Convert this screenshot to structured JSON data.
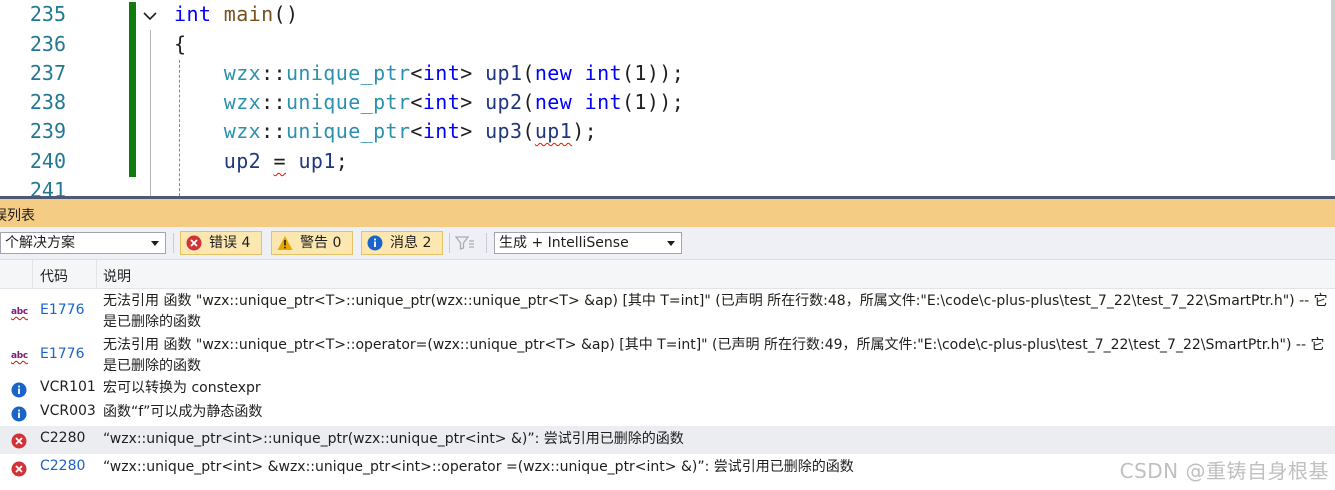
{
  "editor": {
    "lines": [
      {
        "num": "235",
        "tokens": [
          {
            "t": "int",
            "c": "kw"
          },
          {
            "t": " "
          },
          {
            "t": "main",
            "c": "fn"
          },
          {
            "t": "()"
          }
        ]
      },
      {
        "num": "236",
        "tokens": [
          {
            "t": "{"
          }
        ]
      },
      {
        "num": "237",
        "tokens": [
          {
            "t": "    "
          },
          {
            "t": "wzx",
            "c": "ns"
          },
          {
            "t": "::"
          },
          {
            "t": "unique_ptr",
            "c": "ns"
          },
          {
            "t": "<"
          },
          {
            "t": "int",
            "c": "kw"
          },
          {
            "t": "> "
          },
          {
            "t": "up1",
            "c": "var"
          },
          {
            "t": "("
          },
          {
            "t": "new",
            "c": "kw"
          },
          {
            "t": " "
          },
          {
            "t": "int",
            "c": "kw"
          },
          {
            "t": "(1));"
          }
        ]
      },
      {
        "num": "238",
        "tokens": [
          {
            "t": "    "
          },
          {
            "t": "wzx",
            "c": "ns"
          },
          {
            "t": "::"
          },
          {
            "t": "unique_ptr",
            "c": "ns"
          },
          {
            "t": "<"
          },
          {
            "t": "int",
            "c": "kw"
          },
          {
            "t": "> "
          },
          {
            "t": "up2",
            "c": "var"
          },
          {
            "t": "("
          },
          {
            "t": "new",
            "c": "kw"
          },
          {
            "t": " "
          },
          {
            "t": "int",
            "c": "kw"
          },
          {
            "t": "(1));"
          }
        ]
      },
      {
        "num": "239",
        "tokens": [
          {
            "t": "    "
          },
          {
            "t": "wzx",
            "c": "ns"
          },
          {
            "t": "::"
          },
          {
            "t": "unique_ptr",
            "c": "ns"
          },
          {
            "t": "<"
          },
          {
            "t": "int",
            "c": "kw"
          },
          {
            "t": "> "
          },
          {
            "t": "up3",
            "c": "var"
          },
          {
            "t": "("
          },
          {
            "t": "up1",
            "c": "var squig"
          },
          {
            "t": ");"
          }
        ]
      },
      {
        "num": "240",
        "tokens": [
          {
            "t": "    "
          },
          {
            "t": "up2",
            "c": "var"
          },
          {
            "t": " "
          },
          {
            "t": "=",
            "c": "squig"
          },
          {
            "t": " "
          },
          {
            "t": "up1",
            "c": "var"
          },
          {
            "t": ";"
          }
        ]
      },
      {
        "num": "241",
        "tokens": []
      }
    ]
  },
  "panel": {
    "title": "误列表",
    "scope_select": "个解决方案",
    "errors_btn": "错误 4",
    "warnings_btn": "警告 0",
    "messages_btn": "消息 2",
    "build_select": "生成 + IntelliSense",
    "col_code": "代码",
    "col_desc": "说明",
    "rows": [
      {
        "icon": "spelling-abc-icon",
        "code": "E1776",
        "link": true,
        "desc": "无法引用 函数 \"wzx::unique_ptr<T>::unique_ptr(wzx::unique_ptr<T> &ap) [其中 T=int]\" (已声明 所在行数:48，所属文件:\"E:\\code\\c-plus-plus\\test_7_22\\test_7_22\\SmartPtr.h\") -- 它是已删除的函数"
      },
      {
        "icon": "spelling-abc-icon",
        "code": "E1776",
        "link": true,
        "desc": "无法引用 函数 \"wzx::unique_ptr<T>::operator=(wzx::unique_ptr<T> &ap) [其中 T=int]\" (已声明 所在行数:49，所属文件:\"E:\\code\\c-plus-plus\\test_7_22\\test_7_22\\SmartPtr.h\") -- 它是已删除的函数"
      },
      {
        "icon": "info-icon",
        "code": "VCR101",
        "link": false,
        "desc": "宏可以转换为 constexpr"
      },
      {
        "icon": "info-icon",
        "code": "VCR003",
        "link": false,
        "desc": "函数“f”可以成为静态函数"
      },
      {
        "icon": "error-icon",
        "code": "C2280",
        "link": false,
        "desc": "“wzx::unique_ptr<int>::unique_ptr(wzx::unique_ptr<int> &)”: 尝试引用已删除的函数"
      },
      {
        "icon": "error-icon",
        "code": "C2280",
        "link": true,
        "desc": "“wzx::unique_ptr<int> &wzx::unique_ptr<int>::operator =(wzx::unique_ptr<int> &)”: 尝试引用已删除的函数"
      }
    ]
  },
  "watermark": "CSDN @重铸自身根基",
  "colors": {
    "error": "#d13438",
    "info": "#1a63c9",
    "warning": "#e6a700",
    "accent_bar": "#107c10"
  }
}
